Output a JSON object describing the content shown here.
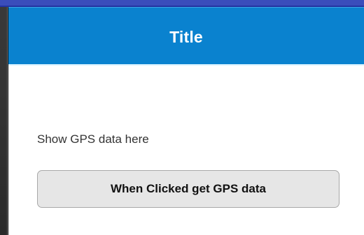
{
  "header": {
    "title": "Title",
    "background": "#0a82cf"
  },
  "main": {
    "gps_label": "Show GPS data here",
    "gps_button_label": "When Clicked get GPS data"
  }
}
